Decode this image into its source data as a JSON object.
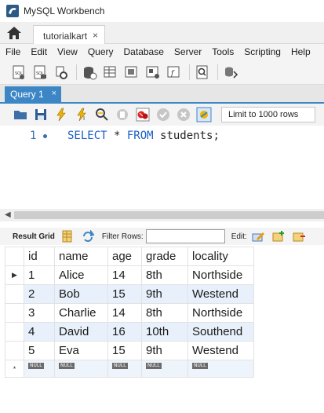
{
  "window": {
    "title": "MySQL Workbench"
  },
  "connection_tab": {
    "label": "tutorialkart",
    "close": "×"
  },
  "menu": [
    "File",
    "Edit",
    "View",
    "Query",
    "Database",
    "Server",
    "Tools",
    "Scripting",
    "Help"
  ],
  "query_tab": {
    "label": "Query 1",
    "close": "×"
  },
  "editor_toolbar": {
    "limit_label": "Limit to 1000 rows"
  },
  "editor": {
    "line_number": "1",
    "code": [
      {
        "text": "SELECT",
        "kind": "keyword"
      },
      {
        "text": " * ",
        "kind": "plain"
      },
      {
        "text": "FROM",
        "kind": "keyword"
      },
      {
        "text": " students;",
        "kind": "plain"
      }
    ]
  },
  "result_toolbar": {
    "grid_label": "Result Grid",
    "filter_label": "Filter Rows:",
    "filter_value": "",
    "edit_label": "Edit:"
  },
  "result": {
    "columns": [
      "id",
      "name",
      "age",
      "grade",
      "locality"
    ],
    "rows": [
      [
        "1",
        "Alice",
        "14",
        "8th",
        "Northside"
      ],
      [
        "2",
        "Bob",
        "15",
        "9th",
        "Westend"
      ],
      [
        "3",
        "Charlie",
        "14",
        "8th",
        "Northside"
      ],
      [
        "4",
        "David",
        "16",
        "10th",
        "Southend"
      ],
      [
        "5",
        "Eva",
        "15",
        "9th",
        "Westend"
      ]
    ],
    "null_label": "NULL",
    "new_row_marker": "*"
  },
  "colors": {
    "accent": "#3d86c6",
    "keyword": "#1a5fc9",
    "alt_row": "#e8f1fb"
  }
}
